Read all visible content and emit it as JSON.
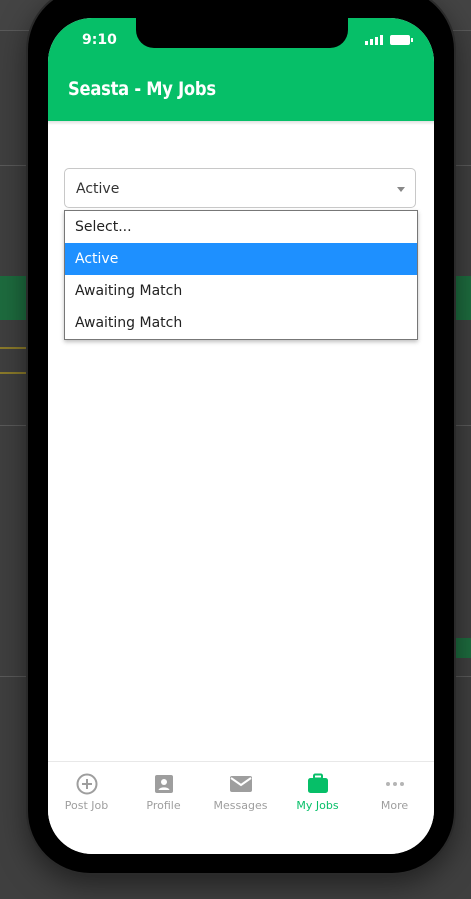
{
  "status_bar": {
    "time": "9:10"
  },
  "header": {
    "title": "Seasta - My Jobs"
  },
  "filter": {
    "selected_value": "Active",
    "options": [
      "Select...",
      "Active",
      "Awaiting Match",
      "Awaiting Match"
    ],
    "highlighted_index": 1
  },
  "tabs": [
    {
      "label": "Post Job",
      "icon": "plus-circle-icon",
      "active": false
    },
    {
      "label": "Profile",
      "icon": "profile-card-icon",
      "active": false
    },
    {
      "label": "Messages",
      "icon": "envelope-icon",
      "active": false
    },
    {
      "label": "My Jobs",
      "icon": "briefcase-icon",
      "active": true
    },
    {
      "label": "More",
      "icon": "more-dots-icon",
      "active": false
    }
  ],
  "colors": {
    "brand_green": "#06bf68",
    "selection_blue": "#1e90ff",
    "tab_inactive": "#9e9e9e"
  }
}
